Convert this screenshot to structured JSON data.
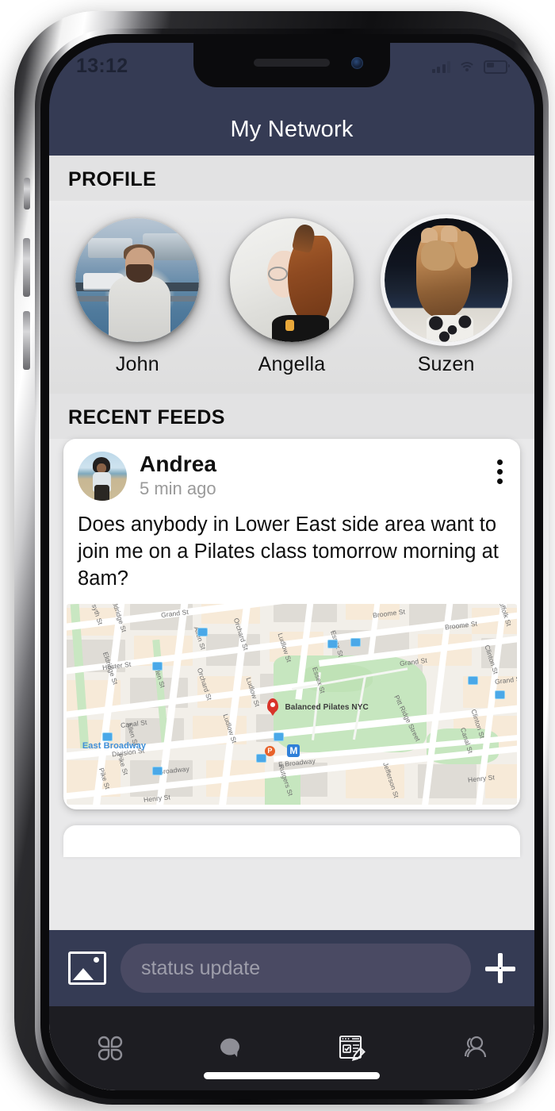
{
  "device": {
    "frame": "iphone-x",
    "home_indicator": true
  },
  "status_bar": {
    "time": "13:12",
    "cellular": "signal-bars-icon",
    "wifi": "wifi-icon",
    "battery": "battery-icon"
  },
  "nav": {
    "title": "My Network"
  },
  "sections": {
    "profile_header": "PROFILE",
    "feeds_header": "RECENT FEEDS"
  },
  "profiles": [
    {
      "name": "John",
      "avatar": "man-by-harbor-photo"
    },
    {
      "name": "Angella",
      "avatar": "woman-red-hair-photo"
    },
    {
      "name": "Suzen",
      "avatar": "cat-photo",
      "ring": true
    }
  ],
  "feed": {
    "posts": [
      {
        "author": "Andrea",
        "avatar": "woman-on-beach-photo",
        "time": "5 min ago",
        "menu_icon": "kebab-menu-icon",
        "text": "Does anybody in Lower East side area want to join me on a Pilates class tomorrow morning at 8am?",
        "map": {
          "place": "Balanced Pilates NYC",
          "transit_label": "East Broadway",
          "subway_badge": "M",
          "parking_badge": "P",
          "streets": [
            "Grand St",
            "Grand St",
            "Grand St",
            "Broome St",
            "Broome St",
            "Hester St",
            "Canal St",
            "Division St",
            "E Broadway",
            "E Broadway",
            "Henry St",
            "Henry St",
            "Allen St",
            "Allen St",
            "Allen St",
            "Orchard St",
            "Orchard St",
            "Ludlow St",
            "Ludlow St",
            "Ludlow St",
            "Essex St",
            "Essex St",
            "Eldridge St",
            "Eldridge St",
            "Forsyth St",
            "Clinton St",
            "Clinton St",
            "Suffolk St",
            "Pike St",
            "Pike St",
            "Rutgers St",
            "Jefferson St",
            "Pitt Ridge Street",
            "Canal St"
          ]
        }
      },
      {
        "author": "",
        "partial": true
      }
    ]
  },
  "composer": {
    "photo_icon": "image-picker-icon",
    "placeholder": "status update",
    "value": "",
    "send_icon": "plus-icon"
  },
  "tabbar": {
    "items": [
      {
        "icon": "apps-grid-icon",
        "active": false
      },
      {
        "icon": "chat-bubble-icon",
        "active": false
      },
      {
        "icon": "form-edit-icon",
        "active": true
      },
      {
        "icon": "contacts-icon",
        "active": false
      }
    ]
  },
  "colors": {
    "nav_bar": "#353B54",
    "section_header_bg": "#E2E2E3",
    "content_bg": "#E9E9EA",
    "card_bg": "#FFFFFF",
    "tabbar_bg": "#1D1D22",
    "compose_field": "#4A4A63",
    "map_pin": "#D8342A",
    "transit_blue": "#3F8FD8"
  }
}
